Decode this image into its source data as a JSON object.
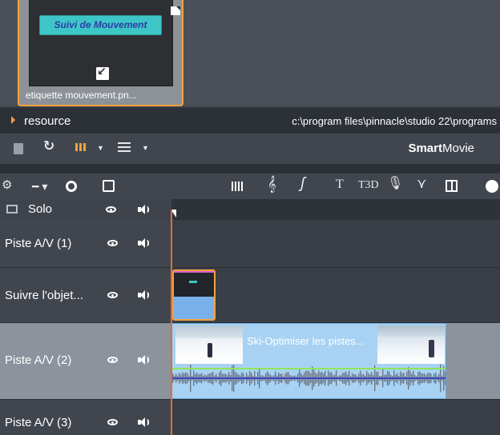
{
  "library": {
    "thumb_title": "Suivi de Mouvement",
    "thumb_label": "etiquette mouvement.pn..."
  },
  "resource": {
    "label": "resource",
    "path": "c:\\program files\\pinnacle\\studio 22\\programs"
  },
  "toolbar": {
    "smartmovie_bold": "Smart",
    "smartmovie_rest": "Movie",
    "icons": [
      "copy-icon",
      "refresh-icon",
      "grid-view-icon",
      "list-view-icon"
    ]
  },
  "timeline_toolbar": {
    "icons": [
      "gear-icon",
      "marker-dropdown-icon",
      "disc-icon",
      "export-icon",
      "audio-levels-icon",
      "music-clef-icon",
      "motion-path-icon",
      "title-icon",
      "title-3d-icon",
      "microphone-icon",
      "curve-icon",
      "panel-icon",
      "color-ball-icon"
    ],
    "title_glyph": "T",
    "title3d_glyph": "T3D"
  },
  "tracks": {
    "solo": "Solo",
    "track1": "Piste A/V (1)",
    "follow": "Suivre l'objet...",
    "track2": "Piste A/V (2)",
    "track3": "Piste A/V (3)"
  },
  "clips": {
    "ski_title": "Ski-Optimiser les pistes..."
  },
  "colors": {
    "accent": "#f0a43a",
    "playhead": "#e66a3a",
    "clip_blue": "#a7d2f3"
  }
}
